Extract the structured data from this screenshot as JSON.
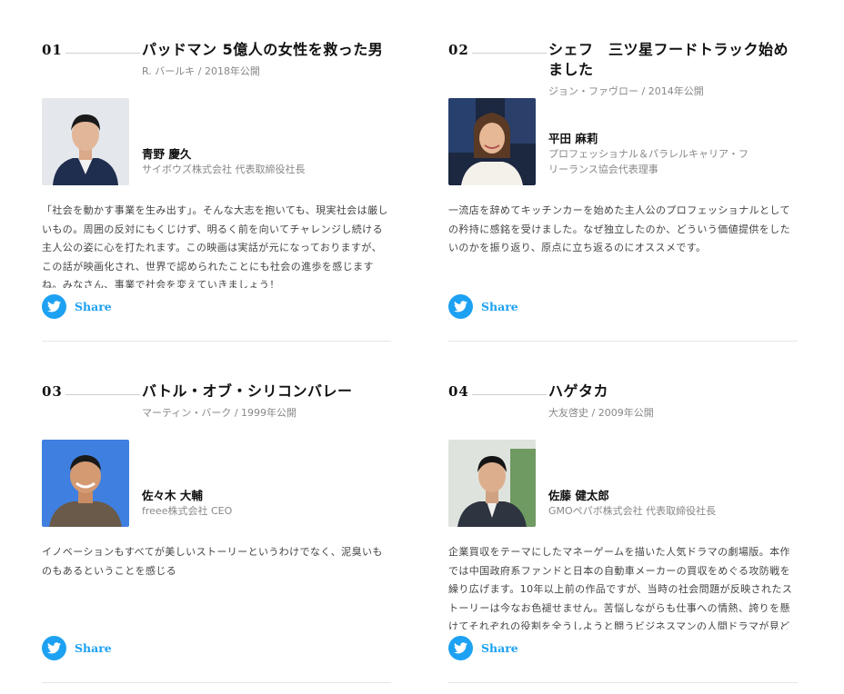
{
  "colors": {
    "twitter": "#1da1f2",
    "text": "#111111",
    "muted": "#888888"
  },
  "cards": [
    {
      "number": "01",
      "title": "パッドマン 5億人の女性を救った男",
      "meta": "R. バールキ / 2018年公開",
      "person": {
        "name": "青野 慶久",
        "role": "サイボウズ株式会社 代表取締役社長"
      },
      "description": "「社会を動かす事業を生み出す」。そんな大志を抱いても、現実社会は厳しいもの。周囲の反対にもくじけず、明るく前を向いてチャレンジし続ける主人公の姿に心を打たれます。この映画は実話が元になっておりますが、この話が映画化され、世界で認められたことにも社会の進歩を感じますね。みなさん、事業で社会を変えていきましょう！",
      "share_label": "Share",
      "share_icon": "twitter-icon"
    },
    {
      "number": "02",
      "title": "シェフ　三ツ星フードトラック始めました",
      "meta": "ジョン・ファヴロー / 2014年公開",
      "person": {
        "name": "平田 麻莉",
        "role": "プロフェッショナル＆パラレルキャリア・フリーランス協会代表理事"
      },
      "description": "一流店を辞めてキッチンカーを始めた主人公のプロフェッショナルとしての矜持に感銘を受けました。なぜ独立したのか、どういう価値提供をしたいのかを振り返り、原点に立ち返るのにオススメです。",
      "share_label": "Share",
      "share_icon": "twitter-icon"
    },
    {
      "number": "03",
      "title": "バトル・オブ・シリコンバレー",
      "meta": "マーティン・バーク / 1999年公開",
      "person": {
        "name": "佐々木 大輔",
        "role": "freee株式会社 CEO"
      },
      "description": "イノベーションもすべてが美しいストーリーというわけでなく、泥臭いものもあるということを感じる",
      "share_label": "Share",
      "share_icon": "twitter-icon"
    },
    {
      "number": "04",
      "title": "ハゲタカ",
      "meta": "大友啓史 / 2009年公開",
      "person": {
        "name": "佐藤 健太郎",
        "role": "GMOペパボ株式会社 代表取締役社長"
      },
      "description": "企業買収をテーマにしたマネーゲームを描いた人気ドラマの劇場版。本作では中国政府系ファンドと日本の自動車メーカーの買収をめぐる攻防戦を繰り広げます。10年以上前の作品ですが、当時の社会問題が反映されたストーリーは今なお色褪せません。苦悩しながらも仕事への情熱、誇りを懸けてそれぞれの役割を全うしようと闘うビジネスマンの人間ドラマが見どころです。",
      "share_label": "Share",
      "share_icon": "twitter-icon"
    }
  ]
}
